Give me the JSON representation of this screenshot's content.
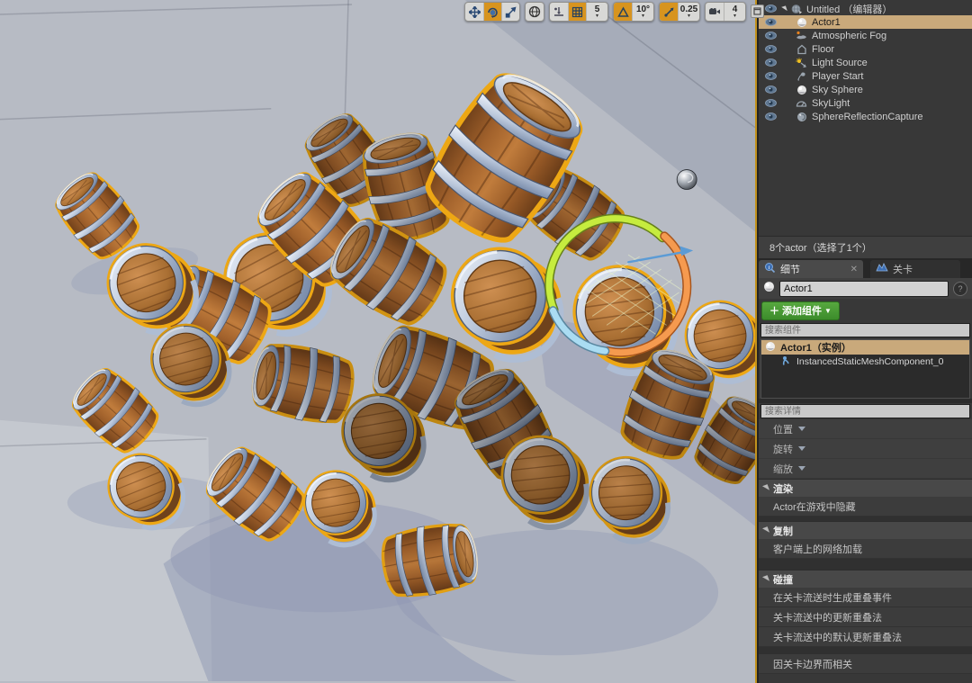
{
  "viewport": {
    "toolbar": {
      "tools": [
        {
          "name": "move",
          "selected": false
        },
        {
          "name": "rotate",
          "selected": true
        },
        {
          "name": "scale",
          "selected": false
        }
      ],
      "world_space_toggle": "globe",
      "surface_snap_on": false,
      "grid_snap_on": true,
      "grid_snap_value": "5",
      "rotation_snap_on": true,
      "rotation_snap_value": "10°",
      "scale_snap_on": true,
      "scale_snap_value": "0.25",
      "camera_speed_value": "4"
    },
    "scene_description": "pile of wooden barrels selected with orange outline, rotation gizmo on one barrel, chrome reflection sphere, gray tiled floor"
  },
  "outliner": {
    "items": [
      {
        "label": "Untitled （编辑器）",
        "icon": "world-icon",
        "selected": false
      },
      {
        "label": "Actor1",
        "icon": "sphere-icon",
        "selected": true
      },
      {
        "label": "Atmospheric Fog",
        "icon": "fog-icon",
        "selected": false
      },
      {
        "label": "Floor",
        "icon": "floor-icon",
        "selected": false
      },
      {
        "label": "Light Source",
        "icon": "light-icon",
        "selected": false
      },
      {
        "label": "Player Start",
        "icon": "player-start-icon",
        "selected": false
      },
      {
        "label": "Sky Sphere",
        "icon": "sphere-icon",
        "selected": false
      },
      {
        "label": "SkyLight",
        "icon": "skylight-icon",
        "selected": false
      },
      {
        "label": "SphereReflectionCapture",
        "icon": "reflection-capture-icon",
        "selected": false
      }
    ],
    "status": "8个actor（选择了1个）"
  },
  "details": {
    "tabs": [
      {
        "label": "细节",
        "active": true
      },
      {
        "label": "关卡",
        "active": false
      }
    ],
    "actor_name": "Actor1",
    "add_component_label": "添加组件",
    "search_components_placeholder": "搜索组件",
    "component_tree": [
      {
        "label": "Actor1（实例）",
        "selected": true
      },
      {
        "label": "InstancedStaticMeshComponent_0",
        "selected": false
      }
    ],
    "search_details_placeholder": "搜索详情",
    "transform_rows": [
      {
        "label": "位置"
      },
      {
        "label": "旋转"
      },
      {
        "label": "缩放"
      }
    ],
    "sections": [
      {
        "title": "渲染",
        "rows": [
          "Actor在游戏中隐藏"
        ]
      },
      {
        "title": "复制",
        "rows": [
          "客户端上的网络加载"
        ]
      },
      {
        "title": "碰撞",
        "rows": [
          "在关卡流送时生成重叠事件",
          "关卡流送中的更新重叠法",
          "关卡流送中的默认更新重叠法"
        ]
      }
    ],
    "extra_row": "因关卡边界而相关"
  },
  "colors": {
    "selection_outline": "#EDA714",
    "selected_row": "#C9A97B",
    "add_component_green": "#3F9B34",
    "toolbar_active_orange": "#D7941F",
    "gizmo_green": "#C6EC3E",
    "gizmo_orange": "#F59A4F",
    "gizmo_blue": "#AADCF2",
    "viewport_border": "#C2921D"
  }
}
